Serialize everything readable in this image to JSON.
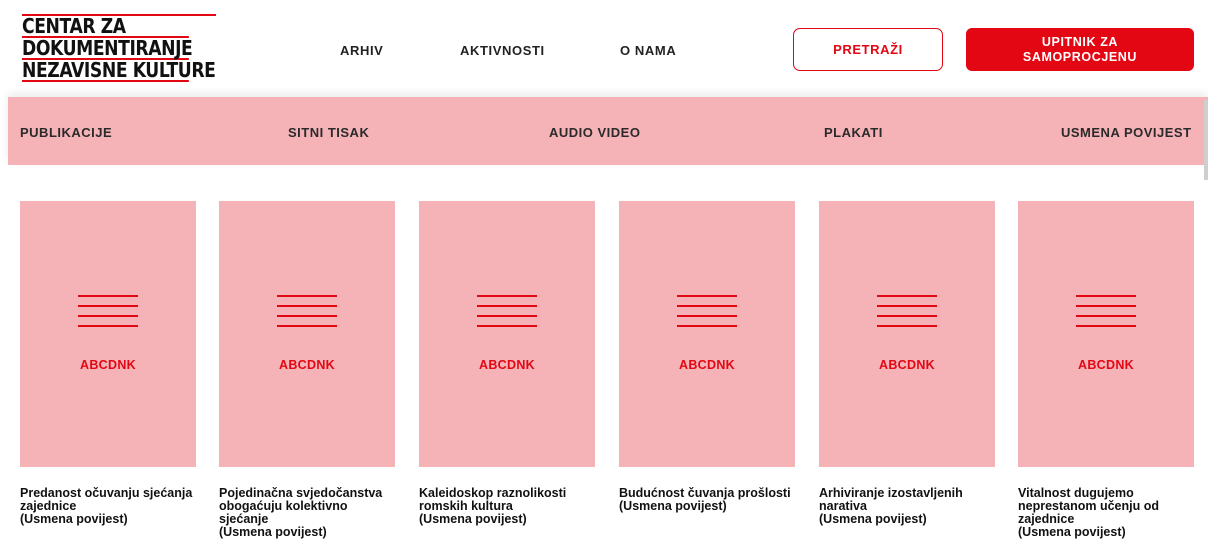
{
  "logo": {
    "lines": [
      "CENTAR ZA",
      "DOKUMENTIRANJE",
      "NEZAVISNE KULTURE"
    ]
  },
  "nav": {
    "items": [
      "ARHIV",
      "AKTIVNOSTI",
      "O NAMA"
    ]
  },
  "buttons": {
    "search": "PRETRAŽI",
    "survey_line1": "UPITNIK ZA",
    "survey_line2": "SAMOPROCJENU"
  },
  "categories": [
    "PUBLIKACIJE",
    "SITNI TISAK",
    "AUDIO VIDEO",
    "PLAKATI",
    "USMENA POVIJEST"
  ],
  "cards": [
    {
      "code": "ABCDNK",
      "title": "Predanost očuvanju sjećanja zajednice",
      "tag": "(Usmena povijest)"
    },
    {
      "code": "ABCDNK",
      "title": "Pojedinačna svjedočanstva obogaćuju kolektivno sjećanje",
      "tag": "(Usmena povijest)"
    },
    {
      "code": "ABCDNK",
      "title": "Kaleidoskop raznolikosti romskih kultura",
      "tag": "(Usmena povijest)"
    },
    {
      "code": "ABCDNK",
      "title": "Budućnost čuvanja prošlosti",
      "tag": "(Usmena povijest)"
    },
    {
      "code": "ABCDNK",
      "title": "Arhiviranje izostavljenih narativa",
      "tag": "(Usmena povijest)"
    },
    {
      "code": "ABCDNK",
      "title": "Vitalnost dugujemo neprestanom učenju od zajednice",
      "tag": "(Usmena povijest)"
    }
  ],
  "colors": {
    "accent": "#e30613",
    "pink": "#f5b3b8"
  }
}
